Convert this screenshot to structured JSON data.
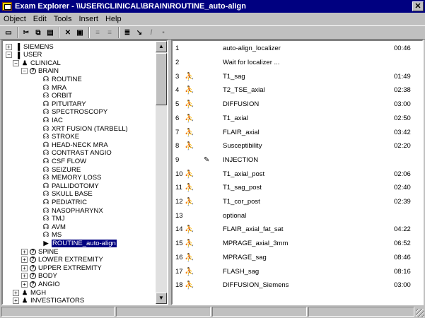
{
  "window": {
    "title": "Exam Explorer - \\\\USER\\CLINICAL\\BRAIN\\ROUTINE_auto-align",
    "close_glyph": "✕"
  },
  "menu": [
    "Object",
    "Edit",
    "Tools",
    "Insert",
    "Help"
  ],
  "toolbar": {
    "buttons": [
      {
        "icon": "open-folder-icon",
        "glyph": "▭",
        "disabled": false
      },
      {
        "icon": "cut-icon",
        "glyph": "✂",
        "disabled": false
      },
      {
        "icon": "copy-icon",
        "glyph": "⧉",
        "disabled": false
      },
      {
        "icon": "paste-icon",
        "glyph": "▤",
        "disabled": false
      },
      {
        "icon": "delete-icon",
        "glyph": "✕",
        "disabled": false
      },
      {
        "icon": "properties-icon",
        "glyph": "▣",
        "disabled": false
      },
      {
        "icon": "move-up-icon",
        "glyph": "≡",
        "disabled": true
      },
      {
        "icon": "move-down-icon",
        "glyph": "≡",
        "disabled": true
      },
      {
        "icon": "insert-icon",
        "glyph": "≣",
        "disabled": false
      },
      {
        "icon": "arrow-icon",
        "glyph": "↘",
        "disabled": false
      },
      {
        "icon": "edit-icon",
        "glyph": "/",
        "disabled": true
      },
      {
        "icon": "save-icon",
        "glyph": "▪",
        "disabled": true
      }
    ]
  },
  "tree": [
    {
      "label": "SIEMENS",
      "level": 0,
      "icon": "book-icon",
      "glyph": "▐",
      "exp": "+"
    },
    {
      "label": "USER",
      "level": 0,
      "icon": "book-icon",
      "glyph": "▐",
      "exp": "−"
    },
    {
      "label": "CLINICAL",
      "level": 1,
      "icon": "person-icon",
      "glyph": "♟",
      "exp": "−"
    },
    {
      "label": "BRAIN",
      "level": 2,
      "icon": "region-icon",
      "glyph": "?",
      "exp": "−"
    },
    {
      "label": "ROUTINE",
      "level": 3,
      "icon": "stethoscope-icon",
      "glyph": "☊",
      "exp": ""
    },
    {
      "label": "MRA",
      "level": 3,
      "icon": "stethoscope-icon",
      "glyph": "☊",
      "exp": ""
    },
    {
      "label": "ORBIT",
      "level": 3,
      "icon": "stethoscope-icon",
      "glyph": "☊",
      "exp": ""
    },
    {
      "label": "PITUITARY",
      "level": 3,
      "icon": "stethoscope-icon",
      "glyph": "☊",
      "exp": ""
    },
    {
      "label": "SPECTROSCOPY",
      "level": 3,
      "icon": "stethoscope-icon",
      "glyph": "☊",
      "exp": ""
    },
    {
      "label": "IAC",
      "level": 3,
      "icon": "stethoscope-icon",
      "glyph": "☊",
      "exp": ""
    },
    {
      "label": "XRT FUSION (TARBELL)",
      "level": 3,
      "icon": "stethoscope-icon",
      "glyph": "☊",
      "exp": ""
    },
    {
      "label": "STROKE",
      "level": 3,
      "icon": "stethoscope-icon",
      "glyph": "☊",
      "exp": ""
    },
    {
      "label": "HEAD-NECK MRA",
      "level": 3,
      "icon": "stethoscope-icon",
      "glyph": "☊",
      "exp": ""
    },
    {
      "label": "CONTRAST ANGIO",
      "level": 3,
      "icon": "stethoscope-icon",
      "glyph": "☊",
      "exp": ""
    },
    {
      "label": "CSF FLOW",
      "level": 3,
      "icon": "stethoscope-icon",
      "glyph": "☊",
      "exp": ""
    },
    {
      "label": "SEIZURE",
      "level": 3,
      "icon": "stethoscope-icon",
      "glyph": "☊",
      "exp": ""
    },
    {
      "label": "MEMORY LOSS",
      "level": 3,
      "icon": "stethoscope-icon",
      "glyph": "☊",
      "exp": ""
    },
    {
      "label": "PALLIDOTOMY",
      "level": 3,
      "icon": "stethoscope-icon",
      "glyph": "☊",
      "exp": ""
    },
    {
      "label": "SKULL BASE",
      "level": 3,
      "icon": "stethoscope-icon",
      "glyph": "☊",
      "exp": ""
    },
    {
      "label": "PEDIATRIC",
      "level": 3,
      "icon": "stethoscope-icon",
      "glyph": "☊",
      "exp": ""
    },
    {
      "label": "NASOPHARYNX",
      "level": 3,
      "icon": "stethoscope-icon",
      "glyph": "☊",
      "exp": ""
    },
    {
      "label": "TMJ",
      "level": 3,
      "icon": "stethoscope-icon",
      "glyph": "☊",
      "exp": ""
    },
    {
      "label": "AVM",
      "level": 3,
      "icon": "stethoscope-icon",
      "glyph": "☊",
      "exp": ""
    },
    {
      "label": "MS",
      "level": 3,
      "icon": "stethoscope-icon",
      "glyph": "☊",
      "exp": ""
    },
    {
      "label": "ROUTINE_auto-align",
      "level": 3,
      "icon": "play-icon",
      "glyph": "▶",
      "exp": "",
      "selected": true
    },
    {
      "label": "SPINE",
      "level": 2,
      "icon": "region-icon",
      "glyph": "?",
      "exp": "+"
    },
    {
      "label": "LOWER EXTREMITY",
      "level": 2,
      "icon": "region-icon",
      "glyph": "?",
      "exp": "+"
    },
    {
      "label": "UPPER EXTREMITY",
      "level": 2,
      "icon": "region-icon",
      "glyph": "?",
      "exp": "+"
    },
    {
      "label": "BODY",
      "level": 2,
      "icon": "region-icon",
      "glyph": "?",
      "exp": "+"
    },
    {
      "label": "ANGIO",
      "level": 2,
      "icon": "region-icon",
      "glyph": "?",
      "exp": "+"
    },
    {
      "label": "MGH",
      "level": 1,
      "icon": "person-icon",
      "glyph": "♟",
      "exp": "+"
    },
    {
      "label": "INVESTIGATORS",
      "level": 1,
      "icon": "person-icon",
      "glyph": "♟",
      "exp": "+"
    }
  ],
  "list": [
    {
      "num": "1",
      "name": "auto-align_localizer",
      "time": "00:46",
      "patient_icon": false,
      "inject_icon": false
    },
    {
      "num": "2",
      "name": "Wait for localizer ...",
      "time": "",
      "patient_icon": false,
      "inject_icon": false
    },
    {
      "num": "3",
      "name": "T1_sag",
      "time": "01:49",
      "patient_icon": true,
      "inject_icon": false
    },
    {
      "num": "4",
      "name": "T2_TSE_axial",
      "time": "02:38",
      "patient_icon": true,
      "inject_icon": false
    },
    {
      "num": "5",
      "name": "DIFFUSION",
      "time": "03:00",
      "patient_icon": true,
      "inject_icon": false
    },
    {
      "num": "6",
      "name": "T1_axial",
      "time": "02:50",
      "patient_icon": true,
      "inject_icon": false
    },
    {
      "num": "7",
      "name": "FLAIR_axial",
      "time": "03:42",
      "patient_icon": true,
      "inject_icon": false
    },
    {
      "num": "8",
      "name": "Susceptibility",
      "time": "02:20",
      "patient_icon": true,
      "inject_icon": false
    },
    {
      "num": "9",
      "name": "INJECTION",
      "time": "",
      "patient_icon": false,
      "inject_icon": true
    },
    {
      "num": "10",
      "name": "T1_axial_post",
      "time": "02:06",
      "patient_icon": true,
      "inject_icon": false
    },
    {
      "num": "11",
      "name": "T1_sag_post",
      "time": "02:40",
      "patient_icon": true,
      "inject_icon": false
    },
    {
      "num": "12",
      "name": "T1_cor_post",
      "time": "02:39",
      "patient_icon": true,
      "inject_icon": false
    },
    {
      "num": "13",
      "name": "optional",
      "time": "",
      "patient_icon": false,
      "inject_icon": false
    },
    {
      "num": "14",
      "name": "FLAIR_axial_fat_sat",
      "time": "04:22",
      "patient_icon": true,
      "inject_icon": false
    },
    {
      "num": "15",
      "name": "MPRAGE_axial_3mm",
      "time": "06:52",
      "patient_icon": true,
      "inject_icon": false
    },
    {
      "num": "16",
      "name": "MPRAGE_sag",
      "time": "08:46",
      "patient_icon": true,
      "inject_icon": false
    },
    {
      "num": "17",
      "name": "FLASH_sag",
      "time": "08:16",
      "patient_icon": true,
      "inject_icon": false
    },
    {
      "num": "18",
      "name": "DIFFUSION_Siemens",
      "time": "03:00",
      "patient_icon": true,
      "inject_icon": false
    }
  ],
  "icons": {
    "patient": "⛹",
    "injection": "✎",
    "scroll_up": "▲",
    "scroll_down": "▼"
  },
  "colors": {
    "title_bg": "#000080",
    "selection_bg": "#000080",
    "window_bg": "#c0c0c0"
  }
}
